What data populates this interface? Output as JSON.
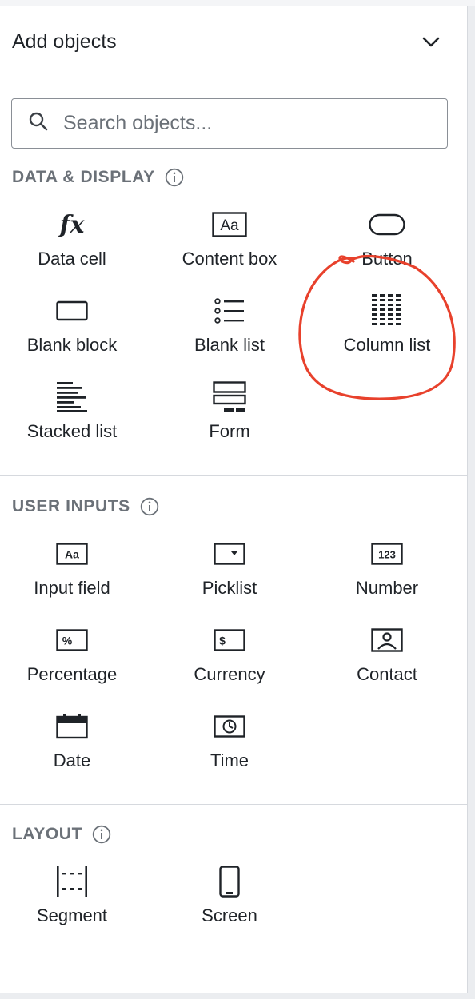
{
  "panel": {
    "title": "Add objects",
    "collapse_icon": "chevron-down-icon"
  },
  "search": {
    "placeholder": "Search objects...",
    "value": "",
    "icon": "search-icon"
  },
  "sections": {
    "data_display": {
      "title": "DATA & DISPLAY",
      "items": [
        {
          "label": "Data cell",
          "icon": "fx-icon"
        },
        {
          "label": "Content box",
          "icon": "text-box-icon"
        },
        {
          "label": "Button",
          "icon": "button-icon"
        },
        {
          "label": "Blank block",
          "icon": "blank-block-icon"
        },
        {
          "label": "Blank list",
          "icon": "list-icon"
        },
        {
          "label": "Column list",
          "icon": "column-list-icon"
        },
        {
          "label": "Stacked list",
          "icon": "stacked-list-icon"
        },
        {
          "label": "Form",
          "icon": "form-icon"
        }
      ]
    },
    "user_inputs": {
      "title": "USER INPUTS",
      "items": [
        {
          "label": "Input field",
          "icon": "input-field-icon",
          "glyph": "Aa"
        },
        {
          "label": "Picklist",
          "icon": "picklist-icon"
        },
        {
          "label": "Number",
          "icon": "number-icon",
          "glyph": "123"
        },
        {
          "label": "Percentage",
          "icon": "percentage-icon",
          "glyph": "%"
        },
        {
          "label": "Currency",
          "icon": "currency-icon",
          "glyph": "$"
        },
        {
          "label": "Contact",
          "icon": "contact-icon"
        },
        {
          "label": "Date",
          "icon": "date-icon"
        },
        {
          "label": "Time",
          "icon": "time-icon"
        }
      ]
    },
    "layout": {
      "title": "LAYOUT",
      "items": [
        {
          "label": "Segment",
          "icon": "segment-icon"
        },
        {
          "label": "Screen",
          "icon": "screen-icon"
        }
      ]
    }
  },
  "annotation": {
    "shape": "hand-drawn circle around Column list",
    "color": "#e8412c"
  },
  "colors": {
    "text": "#1f2328",
    "muted": "#6b7178",
    "border": "#d6d9de"
  }
}
